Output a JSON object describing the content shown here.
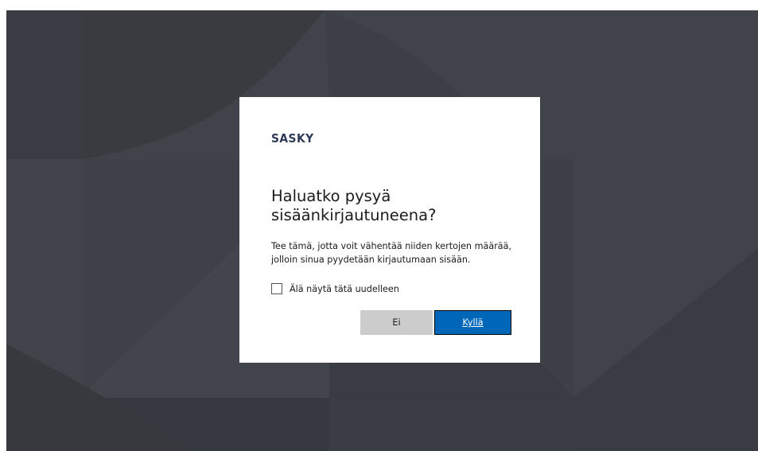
{
  "brand": {
    "logo_text": "SASKY"
  },
  "dialog": {
    "title": "Haluatko pysyä sisäänkirjautuneena?",
    "description": "Tee tämä, jotta voit vähentää niiden kertojen määrää, jolloin sinua pyydetään kirjautumaan sisään.",
    "checkbox_label": "Älä näytä tätä uudelleen",
    "checkbox_checked": false,
    "no_button_label": "Ei",
    "yes_button_label": "Kyllä"
  },
  "colors": {
    "background": "#40434a",
    "dialog_background": "#ffffff",
    "primary_button": "#0067b8",
    "secondary_button": "#cccccc",
    "logo": "#2f3b57"
  }
}
